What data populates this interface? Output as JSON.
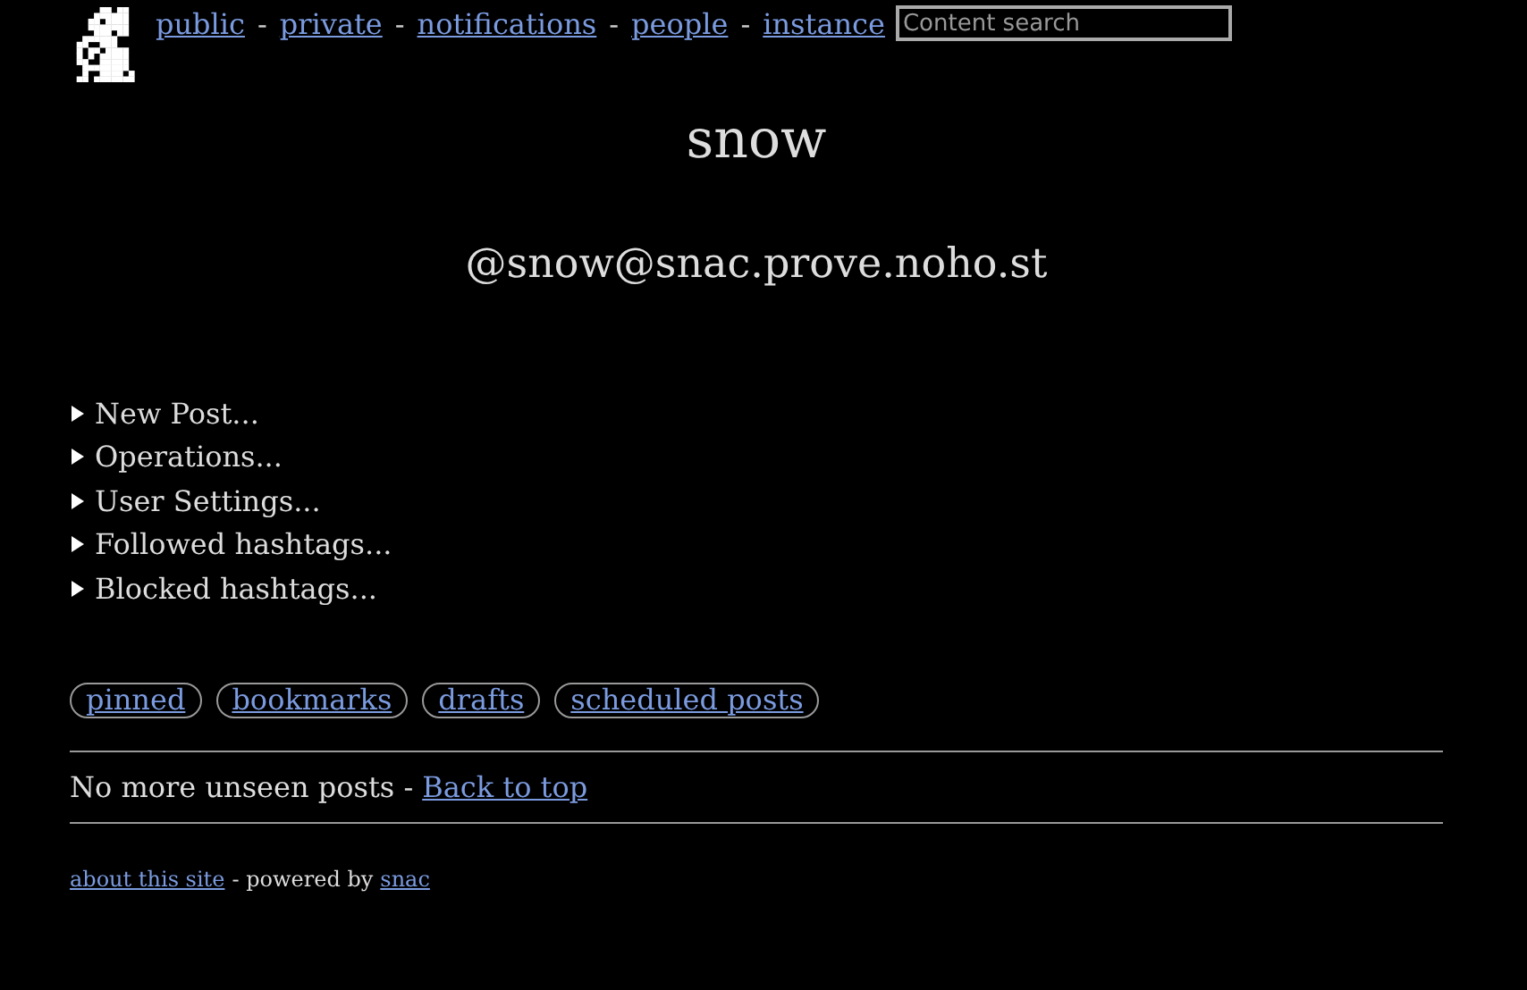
{
  "nav": [
    {
      "kind": "link",
      "text": "public"
    },
    {
      "kind": "separator",
      "text": "-"
    },
    {
      "kind": "link",
      "text": "private"
    },
    {
      "kind": "separator",
      "text": "-"
    },
    {
      "kind": "link",
      "text": "notifications"
    },
    {
      "kind": "separator",
      "text": "-"
    },
    {
      "kind": "link",
      "text": "people"
    },
    {
      "kind": "separator",
      "text": "-"
    },
    {
      "kind": "link",
      "text": "instance"
    }
  ],
  "search": {
    "placeholder": "Content search"
  },
  "title": "snow",
  "handle": "@snow@snac.prove.noho.st",
  "sections": [
    {
      "label": "New Post...",
      "expanded": false
    },
    {
      "label": "Operations...",
      "expanded": false
    },
    {
      "label": "User Settings...",
      "expanded": false
    },
    {
      "label": "Followed hashtags...",
      "expanded": false
    },
    {
      "label": "Blocked hashtags...",
      "expanded": false
    }
  ],
  "filters": [
    "pinned",
    "bookmarks",
    "drafts",
    "scheduled posts"
  ],
  "status": {
    "text": "No more unseen posts -",
    "link": "Back to top"
  },
  "footer": [
    {
      "kind": "link",
      "text": "about this site"
    },
    {
      "kind": "text",
      "text": "- powered by"
    },
    {
      "kind": "link",
      "text": "snac"
    }
  ]
}
